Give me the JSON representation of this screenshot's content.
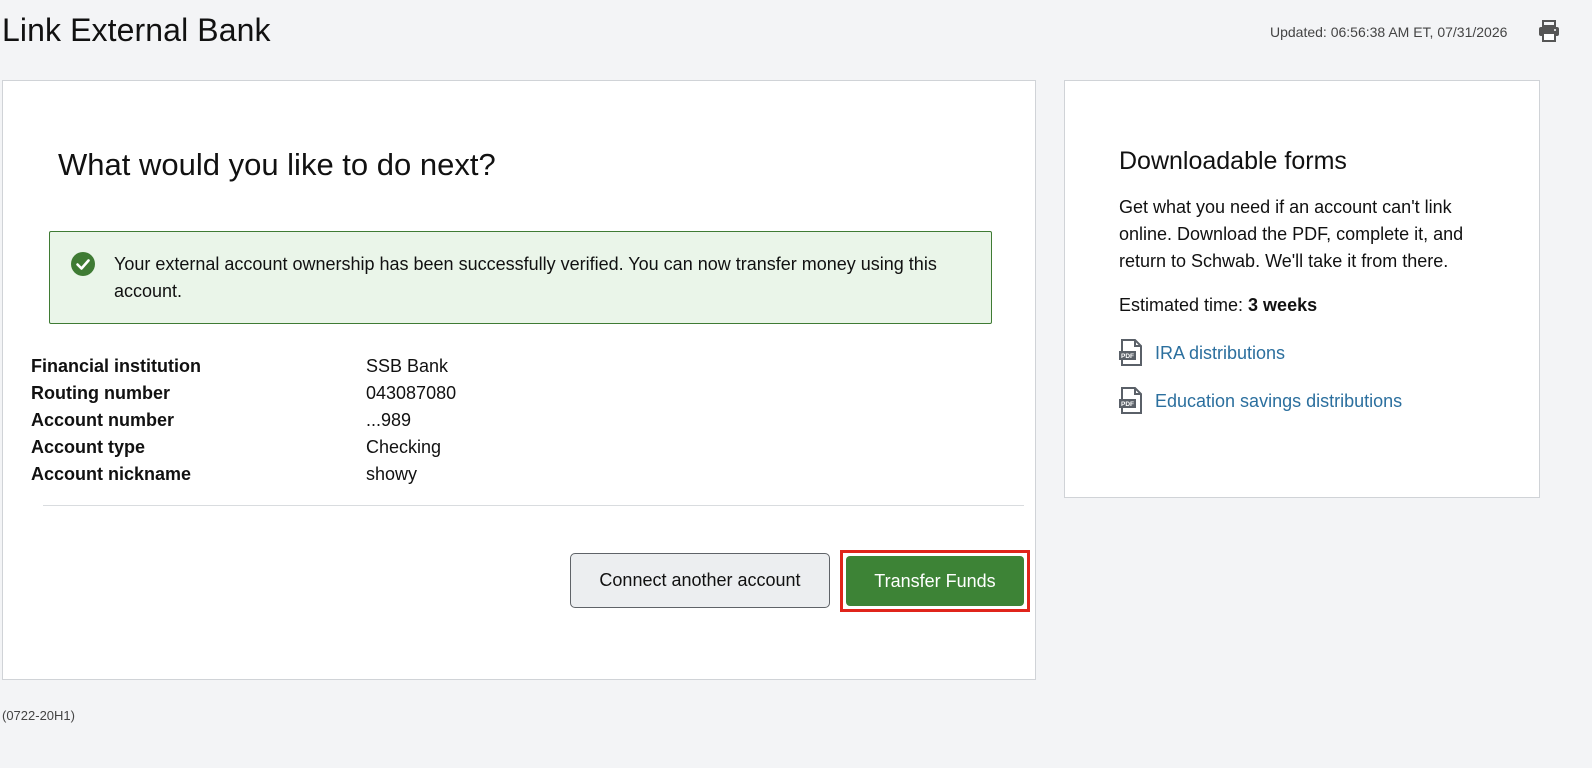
{
  "header": {
    "title": "Link External Bank",
    "updated": "Updated: 06:56:38 AM ET, 07/31/2026",
    "print_icon": "printer-icon"
  },
  "main": {
    "heading": "What would you like to do next?",
    "alert": {
      "icon": "check-circle-icon",
      "message": "Your external account ownership has been successfully verified. You can now transfer money using this account.",
      "color": "#3f7b34"
    },
    "details": [
      {
        "label": "Financial institution",
        "value": "SSB Bank"
      },
      {
        "label": "Routing number",
        "value": "043087080"
      },
      {
        "label": "Account number",
        "value": "...989"
      },
      {
        "label": "Account type",
        "value": "Checking"
      },
      {
        "label": "Account nickname",
        "value": "showy"
      }
    ],
    "connect_button": "Connect another account",
    "transfer_button": "Transfer Funds",
    "primary_color": "#3d8336"
  },
  "sidebar": {
    "heading": "Downloadable forms",
    "description": "Get what you need if an account can't link online. Download the PDF, complete it, and return to Schwab. We'll take it from there.",
    "estimate_label": "Estimated time: ",
    "estimate_value": "3 weeks",
    "links": [
      {
        "label": "IRA distributions",
        "icon": "pdf-icon"
      },
      {
        "label": "Education savings distributions",
        "icon": "pdf-icon"
      }
    ],
    "link_color": "#2b6f9e"
  },
  "footer": {
    "code": "(0722-20H1)"
  }
}
